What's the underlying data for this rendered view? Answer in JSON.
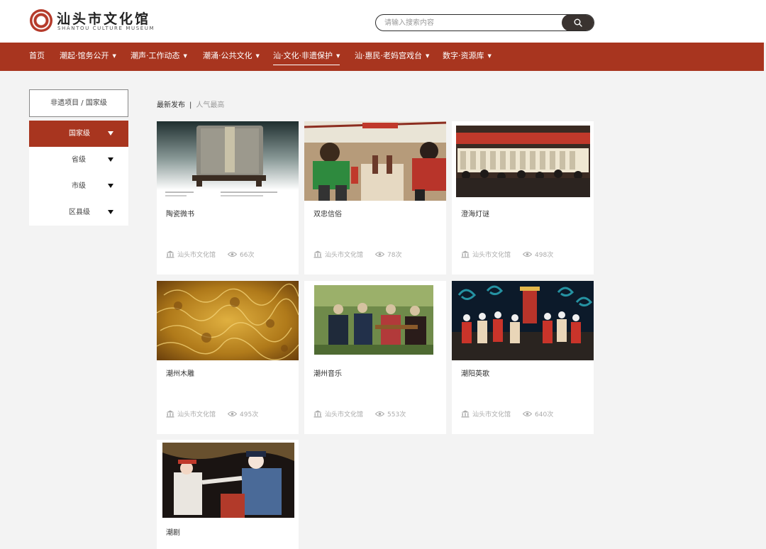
{
  "header": {
    "logo_cn": "汕头市文化馆",
    "logo_en": "SHANTOU CULTURE MUSEUM",
    "search_placeholder": "请输入搜索内容"
  },
  "nav": {
    "items": [
      {
        "label": "首页",
        "dropdown": false
      },
      {
        "label": "潮起·馆务公开",
        "dropdown": true
      },
      {
        "label": "潮声·工作动态",
        "dropdown": true
      },
      {
        "label": "潮涌·公共文化",
        "dropdown": true
      },
      {
        "label": "汕·文化·非遗保护",
        "dropdown": true,
        "active": true
      },
      {
        "label": "汕·惠民·老妈宫戏台",
        "dropdown": true
      },
      {
        "label": "数字·资源库",
        "dropdown": true
      }
    ]
  },
  "sidebar": {
    "breadcrumb": "非遗项目 / 国家级",
    "levels": [
      {
        "label": "国家级",
        "active": true
      },
      {
        "label": "省级"
      },
      {
        "label": "市级"
      },
      {
        "label": "区县级"
      }
    ]
  },
  "sort": {
    "latest": "最新发布",
    "separator": "|",
    "popular": "人气最高"
  },
  "cards": [
    {
      "title": "陶瓷微书",
      "source": "汕头市文化馆",
      "views": "66次"
    },
    {
      "title": "双忠信俗",
      "source": "汕头市文化馆",
      "views": "78次"
    },
    {
      "title": "澄海灯谜",
      "source": "汕头市文化馆",
      "views": "498次"
    },
    {
      "title": "潮州木雕",
      "source": "汕头市文化馆",
      "views": "495次"
    },
    {
      "title": "潮州音乐",
      "source": "汕头市文化馆",
      "views": "553次"
    },
    {
      "title": "潮阳英歌",
      "source": "汕头市文化馆",
      "views": "640次"
    },
    {
      "title": "潮剧"
    }
  ],
  "colors": {
    "brand_red": "#a8351f",
    "search_button": "#3a3330",
    "background": "#f3f3f3"
  },
  "icons": {
    "search": "search-icon",
    "caret": "caret-down-icon",
    "source": "museum-icon",
    "views": "eye-icon"
  }
}
